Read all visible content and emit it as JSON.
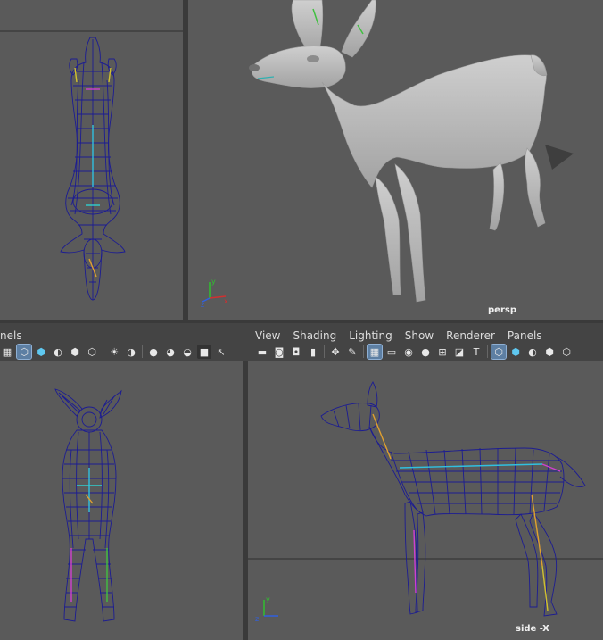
{
  "viewports": {
    "persp_label": "persp",
    "side_label": "side -X"
  },
  "left_menu": {
    "panels_fragment": "nels"
  },
  "menu": {
    "items": [
      "View",
      "Shading",
      "Lighting",
      "Show",
      "Renderer",
      "Panels"
    ]
  },
  "icons": {
    "left_toolbar": [
      "panel-layout-icon",
      "wireframe-cube-icon",
      "smooth-shade-icon",
      "default-material-icon",
      "xray-icon",
      "wireframe-on-shaded-icon",
      "light-icon",
      "shadow-icon",
      "ambient-occlusion-icon",
      "motion-blur-icon",
      "anti-alias-icon",
      "isolate-select-icon",
      "select-tool-icon"
    ],
    "right_toolbar": [
      "select-camera-icon",
      "camera-attributes-icon",
      "bookmarks-icon",
      "image-plane-icon",
      "2d-pan-zoom-icon",
      "grease-pencil-icon",
      "grid-icon",
      "film-gate-icon",
      "resolution-gate-icon",
      "gate-mask-icon",
      "field-chart-icon",
      "safe-action-icon",
      "safe-title-icon",
      "wireframe-cube-icon",
      "smooth-shade-icon",
      "default-material-icon",
      "xray-icon"
    ]
  },
  "colors": {
    "viewport_bg": "#5a5a5a",
    "chrome_bg": "#444444",
    "wireframe": "#1a1a8a",
    "model_gray": "#b8b8b8",
    "axis_x": "#d03030",
    "axis_y": "#30c030",
    "axis_z": "#3060e0"
  }
}
